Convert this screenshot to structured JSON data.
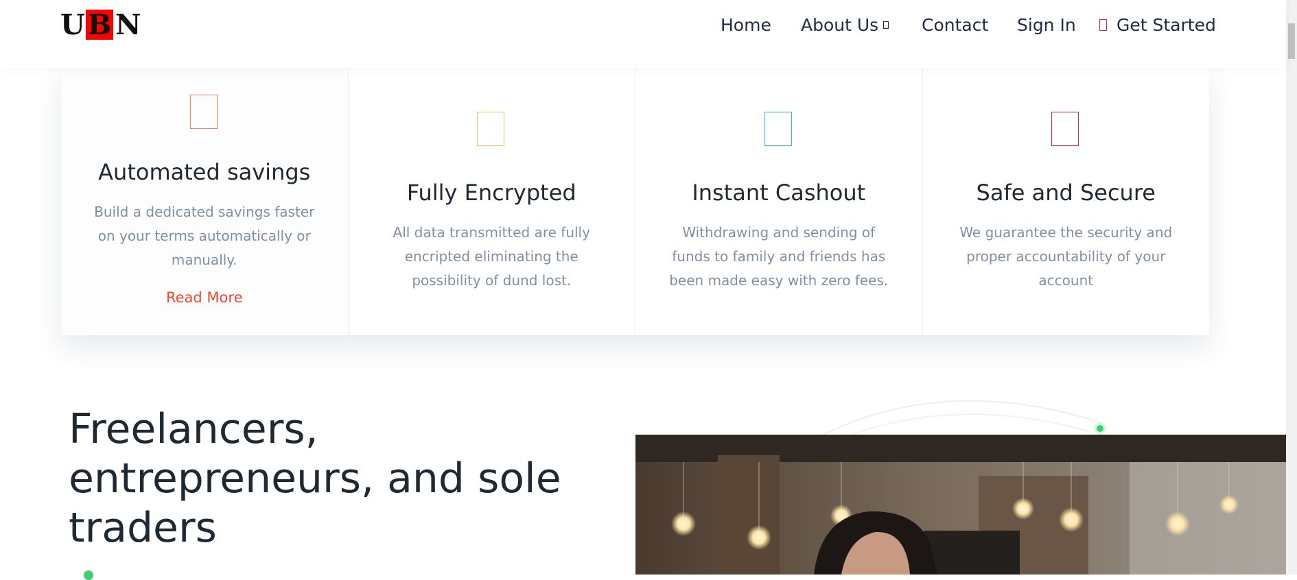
{
  "header": {
    "logo": [
      "U",
      "B",
      "N"
    ],
    "nav": {
      "home": "Home",
      "about": "About Us",
      "contact": "Contact",
      "signin": "Sign In",
      "get_started": "Get Started"
    }
  },
  "features": [
    {
      "title": "Automated savings",
      "text": "Build a dedicated savings faster on your terms automatically or manually.",
      "link": "Read More",
      "icon_color": "#f2815f",
      "icon": "savings-icon"
    },
    {
      "title": "Fully Encrypted",
      "text": "All data transmitted are fully encripted eliminating the possibility of dund lost.",
      "icon_color": "#ffc35a",
      "icon": "encryption-icon"
    },
    {
      "title": "Instant Cashout",
      "text": "Withdrawing and sending of funds to family and friends has been made easy with zero fees.",
      "icon_color": "#2bbfcf",
      "icon": "cashout-icon"
    },
    {
      "title": "Safe and Secure",
      "text": "We guarantee the security and proper accountability of your account",
      "icon_color": "#e0186c",
      "icon": "shield-icon"
    }
  ],
  "hero": {
    "headline": "Freelancers, entrepreneurs, and sole traders"
  },
  "colors": {
    "accent": "#e0186c",
    "link": "#f2472e",
    "muted_text": "#7f8fa4",
    "dot": "#3ecf73"
  }
}
